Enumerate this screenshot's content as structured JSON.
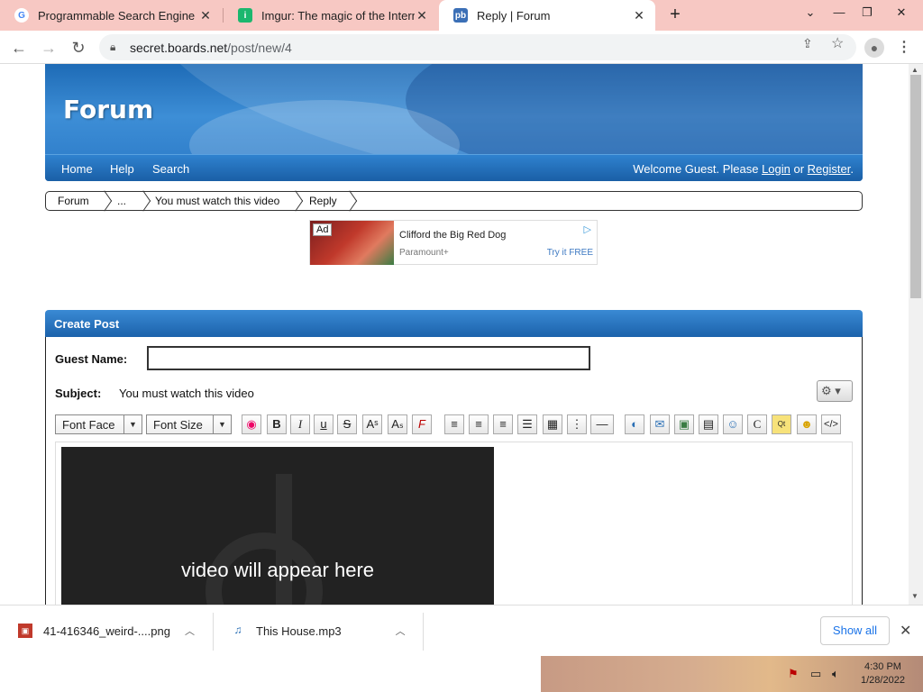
{
  "browser": {
    "tabs": [
      {
        "title": "Programmable Search Engine",
        "favicon": "google-icon"
      },
      {
        "title": "Imgur: The magic of the Internet",
        "favicon": "imgur-icon"
      },
      {
        "title": "Reply | Forum",
        "favicon": "proboards-icon"
      }
    ],
    "url_host": "secret.boards.net",
    "url_path": "/post/new/4"
  },
  "banner": {
    "title": "Forum",
    "nav": [
      "Home",
      "Help",
      "Search"
    ],
    "welcome_prefix": "Welcome Guest. Please ",
    "login": "Login",
    "or": " or ",
    "register": "Register",
    "period": "."
  },
  "breadcrumb": [
    "Forum",
    "...",
    "You must watch this video",
    "Reply"
  ],
  "ad": {
    "badge": "Ad",
    "headline": "Clifford the Big Red Dog",
    "advertiser": "Paramount+",
    "cta": "Try it FREE"
  },
  "post": {
    "header": "Create Post",
    "guest_label": "Guest Name:",
    "guest_value": "",
    "subject_label": "Subject:",
    "subject_value": "You must watch this video",
    "font_face": "Font Face",
    "font_size": "Font Size",
    "video_text": "video will appear here"
  },
  "downloads": {
    "items": [
      {
        "name": "41-416346_weird-....png"
      },
      {
        "name": "This House.mp3"
      }
    ],
    "show_all": "Show all"
  },
  "taskbar": {
    "time": "4:30 PM",
    "date": "1/28/2022"
  },
  "colors": {
    "tab_strip": "#f7c8c3",
    "banner_blue": "#2a78c6",
    "link_blue": "#1a73e8"
  }
}
